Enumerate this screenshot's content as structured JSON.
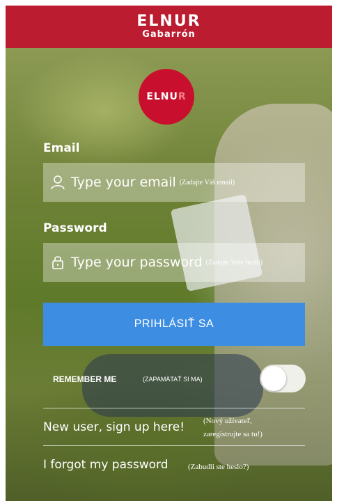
{
  "header": {
    "brand_main": "ELNUR",
    "brand_sub": "Gabarrón"
  },
  "logo": {
    "text_main": "ELNU",
    "text_accent": "R"
  },
  "email": {
    "label": "Email",
    "placeholder": "Type your email",
    "hint": "(Zadajte Váš email)",
    "icon": "user-icon"
  },
  "password": {
    "label": "Password",
    "placeholder": "Type your password",
    "hint": "(Zadajte Vaše heslo)",
    "icon": "lock-icon"
  },
  "login_button": {
    "label": "PRIHLÁSIŤ SA",
    "color": "#3d8ee3"
  },
  "remember": {
    "label": "REMEMBER ME",
    "hint": "(ZAPAMÄTAŤ SI MA)",
    "enabled": false
  },
  "signup": {
    "label": "New user, sign up here!",
    "hint_line1": "(Nový užívateľ,",
    "hint_line2": "zaregistrujte sa tu!)"
  },
  "forgot": {
    "label": "I forgot my password",
    "hint": "(Zabudli ste heslo?)"
  },
  "colors": {
    "brand": "#bb1c2f",
    "logo_circle": "#c8102e"
  }
}
